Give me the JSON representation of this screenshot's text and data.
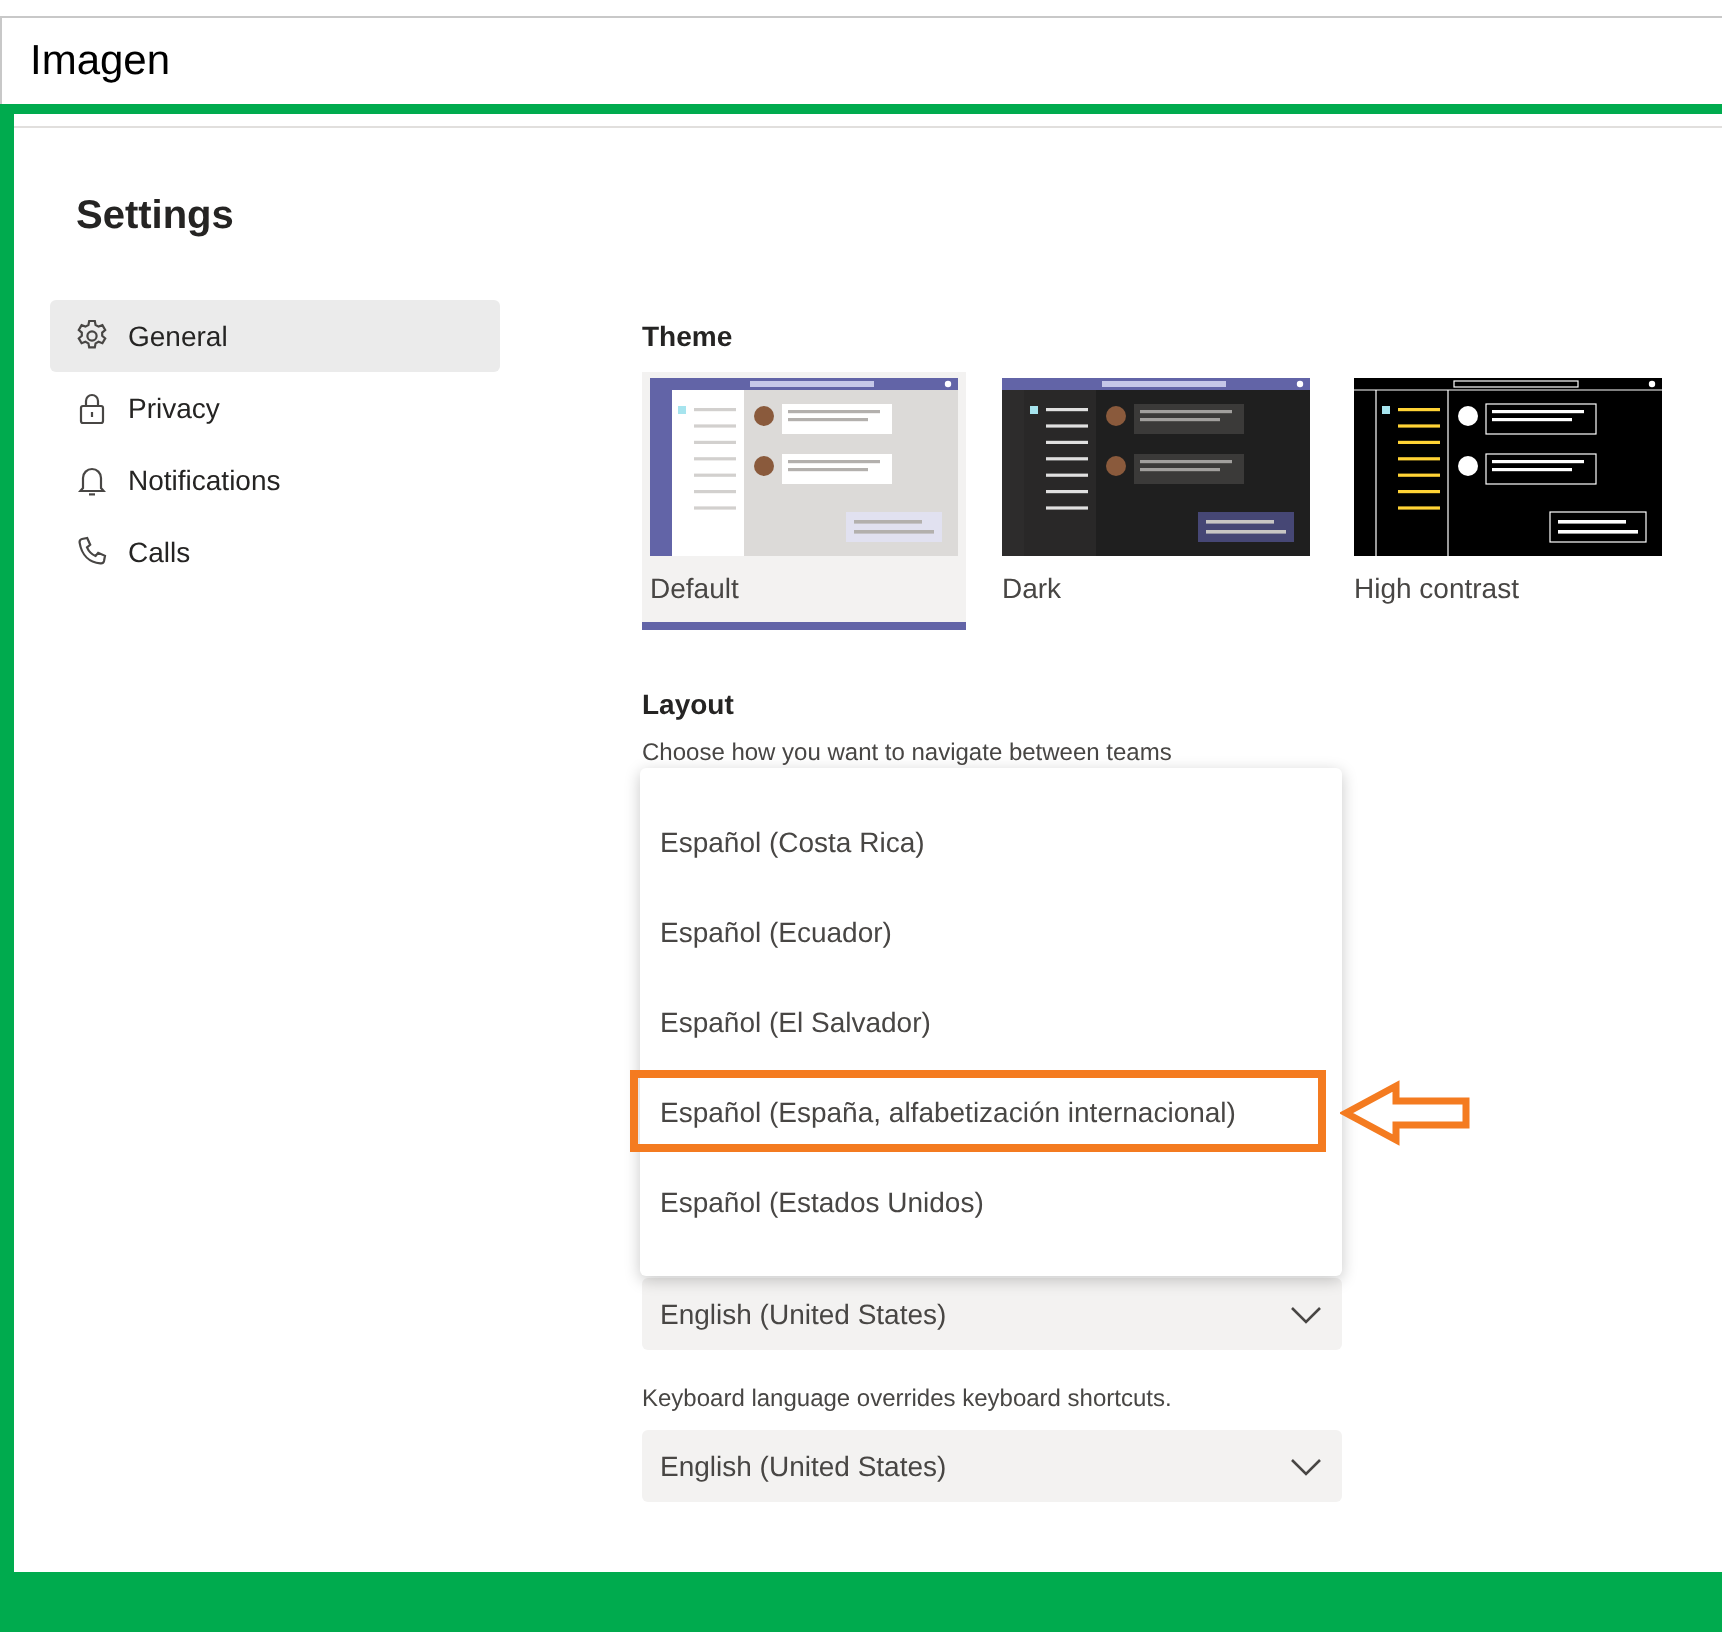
{
  "header": {
    "title": "Imagen"
  },
  "settings": {
    "title": "Settings",
    "nav": [
      {
        "label": "General",
        "kind": "general",
        "selected": true
      },
      {
        "label": "Privacy",
        "kind": "privacy",
        "selected": false
      },
      {
        "label": "Notifications",
        "kind": "notifications",
        "selected": false
      },
      {
        "label": "Calls",
        "kind": "calls",
        "selected": false
      }
    ]
  },
  "theme": {
    "heading": "Theme",
    "options": [
      {
        "label": "Default",
        "kind": "default",
        "selected": true
      },
      {
        "label": "Dark",
        "kind": "dark",
        "selected": false
      },
      {
        "label": "High contrast",
        "kind": "contrast",
        "selected": false
      }
    ]
  },
  "layout": {
    "heading": "Layout",
    "description": "Choose how you want to navigate between teams"
  },
  "language_dropdown": {
    "options": [
      {
        "label": "Español (Costa Rica)",
        "annotated": false
      },
      {
        "label": "Español (Ecuador)",
        "annotated": false
      },
      {
        "label": "Español (El Salvador)",
        "annotated": false
      },
      {
        "label": "Español (España, alfabetización internacional)",
        "annotated": true
      },
      {
        "label": "Español (Estados Unidos)",
        "annotated": false
      }
    ]
  },
  "app_language": {
    "value": "English (United States)"
  },
  "keyboard_language": {
    "note": "Keyboard language overrides keyboard shortcuts.",
    "value": "English (United States)"
  }
}
